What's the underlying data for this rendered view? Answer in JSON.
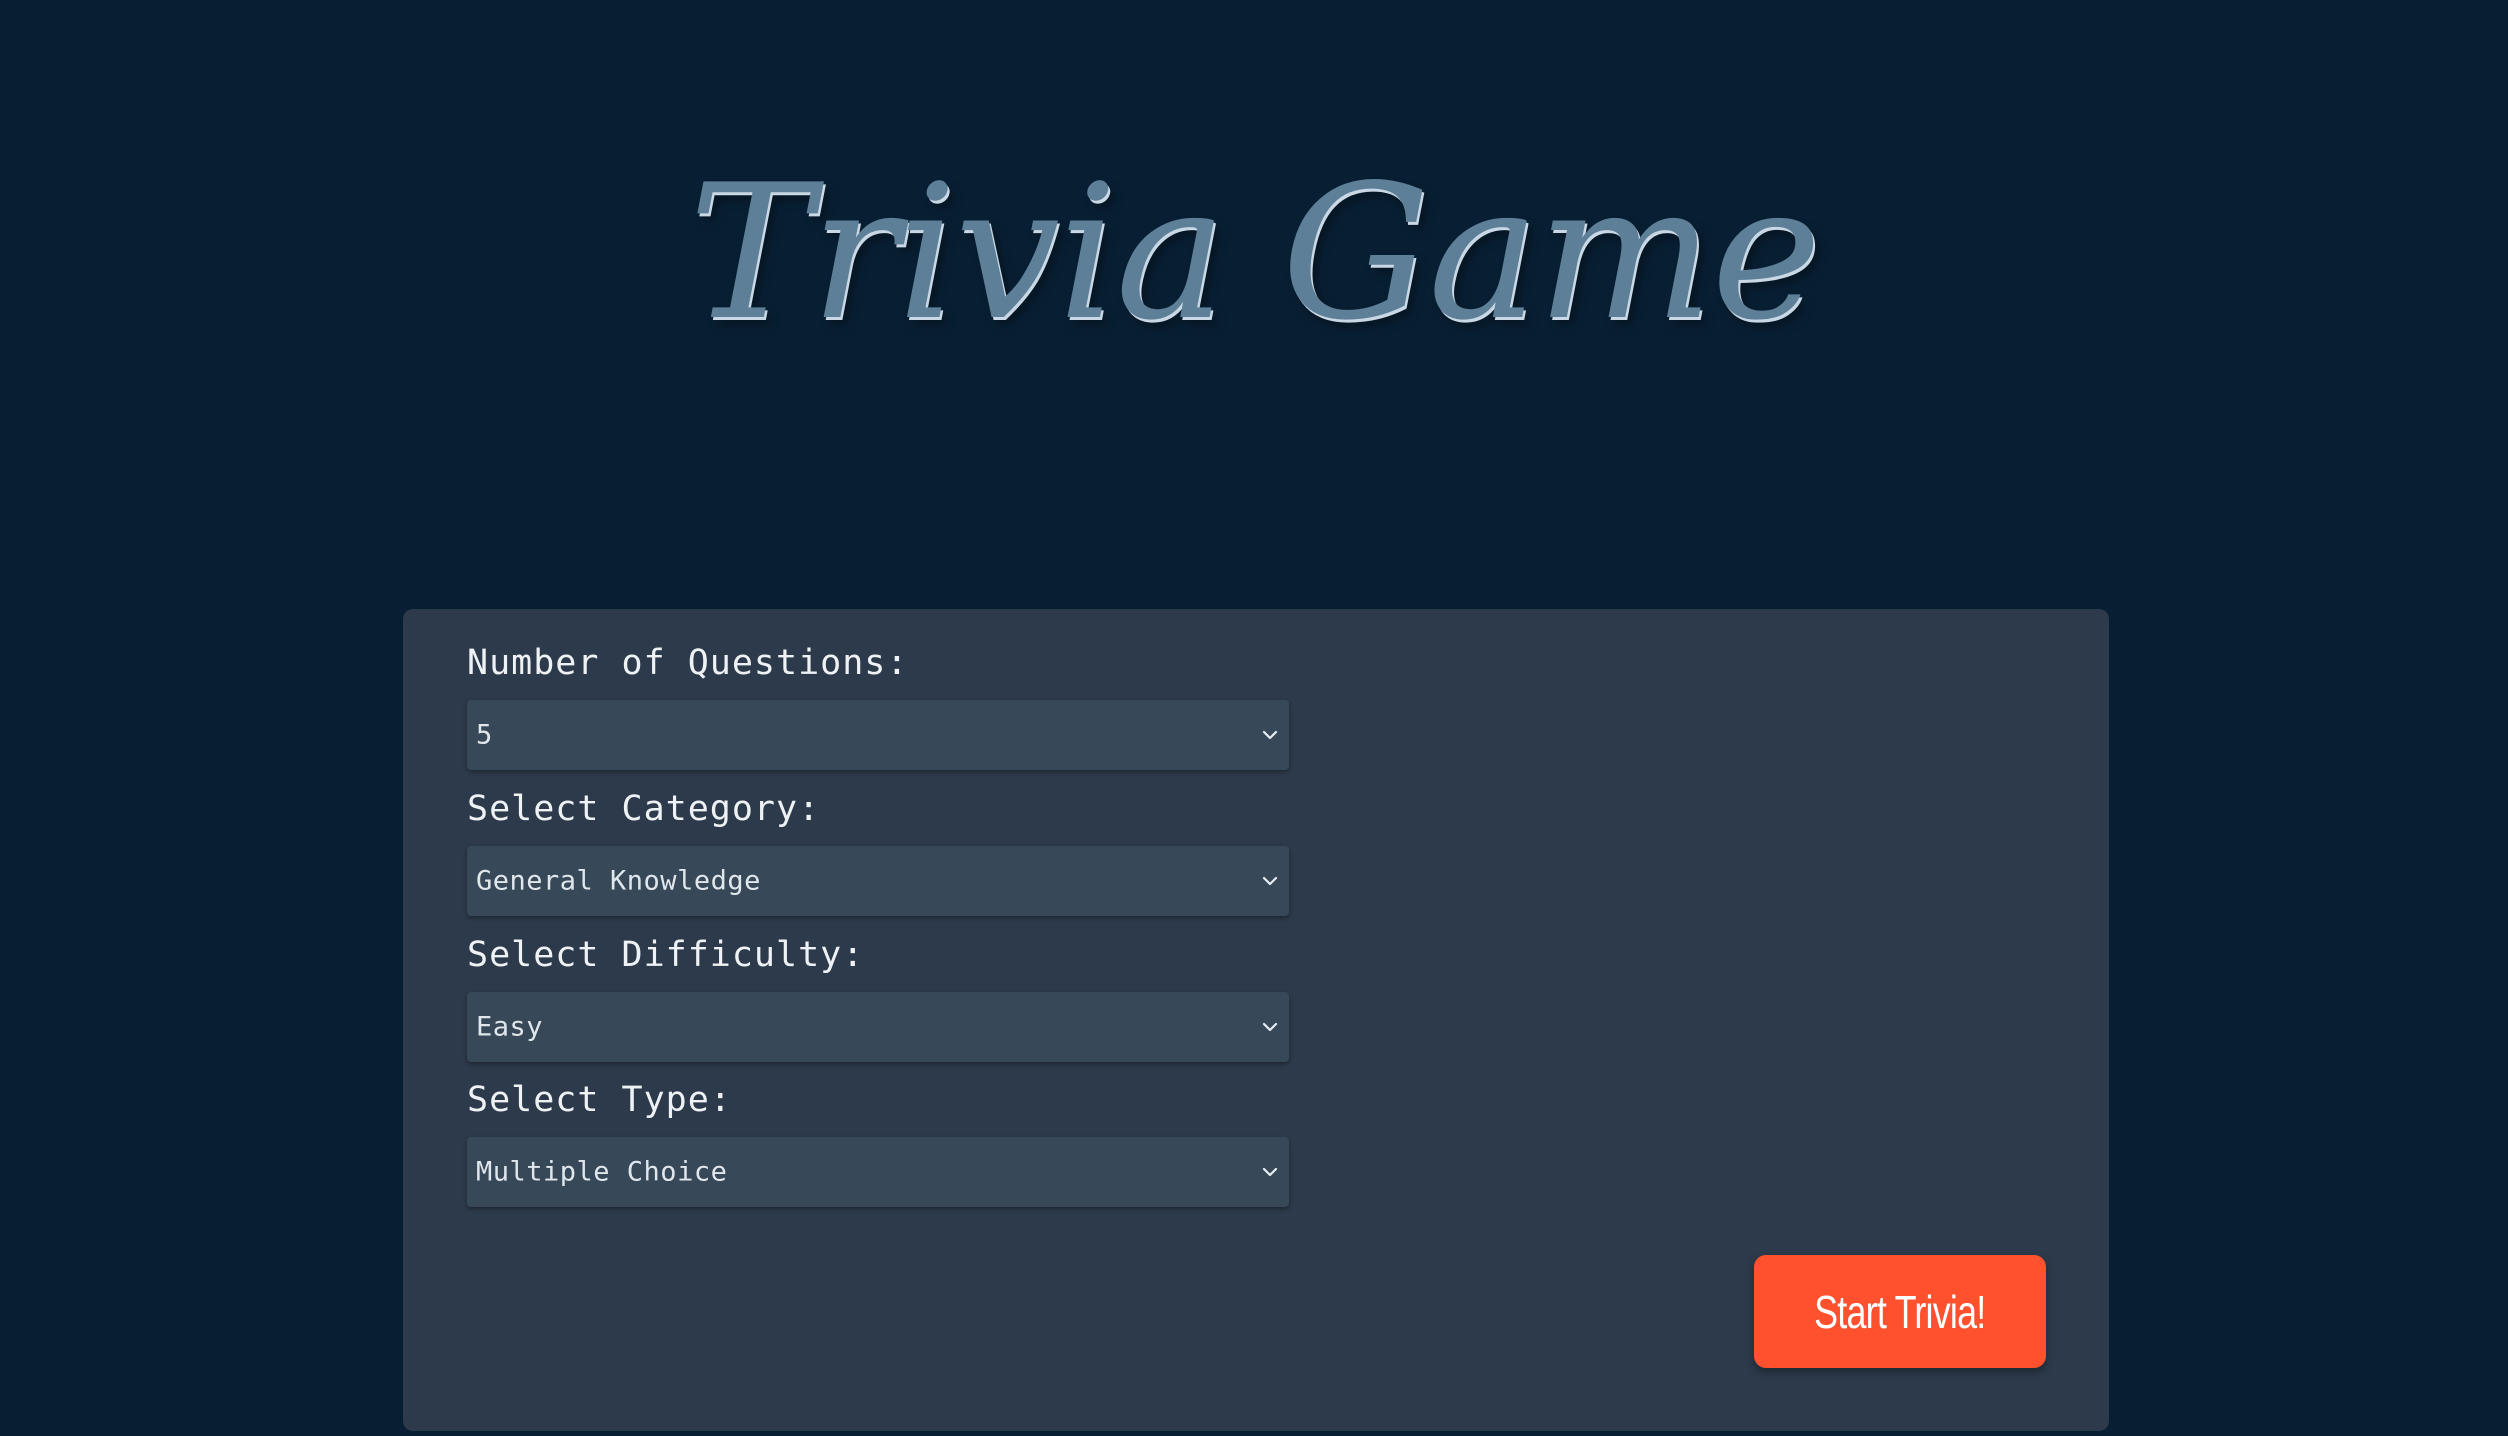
{
  "page": {
    "title": "Trivia Game"
  },
  "form": {
    "fields": [
      {
        "label": "Number of Questions:",
        "value": "5",
        "icon": "chevron-down-icon"
      },
      {
        "label": "Select Category:",
        "value": "General Knowledge",
        "icon": "chevron-down-icon"
      },
      {
        "label": "Select Difficulty:",
        "value": "Easy",
        "icon": "chevron-down-icon"
      },
      {
        "label": "Select Type:",
        "value": "Multiple Choice",
        "icon": "chevron-down-icon"
      }
    ],
    "start_label": "Start Trivia!"
  },
  "colors": {
    "background": "#081f33",
    "panel": "#2d3a4b",
    "select": "#374858",
    "title": "#5e7f98",
    "accent": "#ff512d"
  }
}
